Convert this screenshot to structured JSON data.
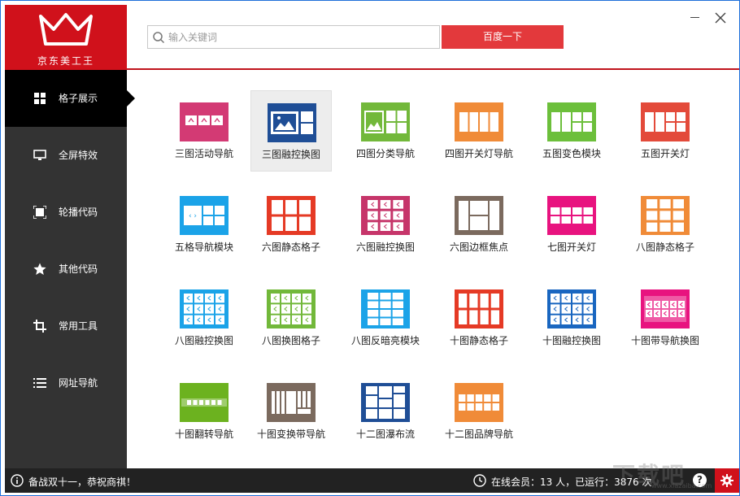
{
  "app": {
    "logo_text": "京东美工王"
  },
  "search": {
    "placeholder": "输入关键词",
    "value": "",
    "button_label": "百度一下"
  },
  "sidebar": {
    "items": [
      {
        "label": "格子展示",
        "icon": "grid-icon",
        "active": true
      },
      {
        "label": "全屏特效",
        "icon": "monitor-icon",
        "active": false
      },
      {
        "label": "轮播代码",
        "icon": "carousel-icon",
        "active": false
      },
      {
        "label": "其他代码",
        "icon": "star-icon",
        "active": false
      },
      {
        "label": "常用工具",
        "icon": "crop-icon",
        "active": false
      },
      {
        "label": "网址导航",
        "icon": "list-icon",
        "active": false
      }
    ]
  },
  "templates": [
    {
      "label": "三图活动导航",
      "color": "#d33a74",
      "layout": "three-arrows",
      "selected": false
    },
    {
      "label": "三图融控换图",
      "color": "#1f4e96",
      "layout": "image-side",
      "selected": true
    },
    {
      "label": "四图分类导航",
      "color": "#72b83a",
      "layout": "image-four",
      "selected": false
    },
    {
      "label": "四图开关灯导航",
      "color": "#f08b38",
      "layout": "four-columns",
      "selected": false
    },
    {
      "label": "五图变色模块",
      "color": "#6cbf3b",
      "layout": "five-mixed",
      "selected": false
    },
    {
      "label": "五图开关灯",
      "color": "#e34a3a",
      "layout": "five-mixed",
      "selected": false
    },
    {
      "label": "五格导航模块",
      "color": "#1ba3e8",
      "layout": "nav-five",
      "selected": false
    },
    {
      "label": "六图静态格子",
      "color": "#e53a25",
      "layout": "grid-3x2",
      "selected": false
    },
    {
      "label": "六图融控换图",
      "color": "#c6356a",
      "layout": "arrows-3x2",
      "selected": false
    },
    {
      "label": "六图边框焦点",
      "color": "#7b6a5e",
      "layout": "border-focus",
      "selected": false
    },
    {
      "label": "七图开关灯",
      "color": "#e8137f",
      "layout": "seven-strip",
      "selected": false
    },
    {
      "label": "八图静态格子",
      "color": "#f08b38",
      "layout": "grid-4x2",
      "selected": false
    },
    {
      "label": "八图融控换图",
      "color": "#1ba3e8",
      "layout": "arrows-4x2",
      "selected": false
    },
    {
      "label": "八图换图格子",
      "color": "#72b83a",
      "layout": "arrows-4x2",
      "selected": false
    },
    {
      "label": "八图反暗亮模块",
      "color": "#1ba3e8",
      "layout": "grid-4x3",
      "selected": false
    },
    {
      "label": "十图静态格子",
      "color": "#e53a25",
      "layout": "grid-5x2",
      "selected": false
    },
    {
      "label": "十图融控换图",
      "color": "#1966c0",
      "layout": "arrows-5x2",
      "selected": false
    },
    {
      "label": "十图带导航换图",
      "color": "#e8137f",
      "layout": "nav-strip",
      "selected": false
    },
    {
      "label": "十图翻转导航",
      "color": "#6cb21f",
      "layout": "dots-strip",
      "selected": false
    },
    {
      "label": "十图变换带导航",
      "color": "#7b6a5e",
      "layout": "bars-strip",
      "selected": false
    },
    {
      "label": "十二图瀑布流",
      "color": "#1f4e96",
      "layout": "waterfall",
      "selected": false
    },
    {
      "label": "十二图品牌导航",
      "color": "#f08b38",
      "layout": "grid-6x2",
      "selected": false
    }
  ],
  "status": {
    "notice": "备战双十一，恭祝商祺！",
    "online_text": "在线会员：13 人，已运行：3876 次",
    "help_label": "?"
  },
  "watermark": {
    "text": "下载吧",
    "sub": "www.xiazaiba.com"
  },
  "colors": {
    "brand_red": "#d0111b",
    "sidebar_bg": "#333333",
    "active_bg": "#000000",
    "button_red": "#e3393c"
  }
}
